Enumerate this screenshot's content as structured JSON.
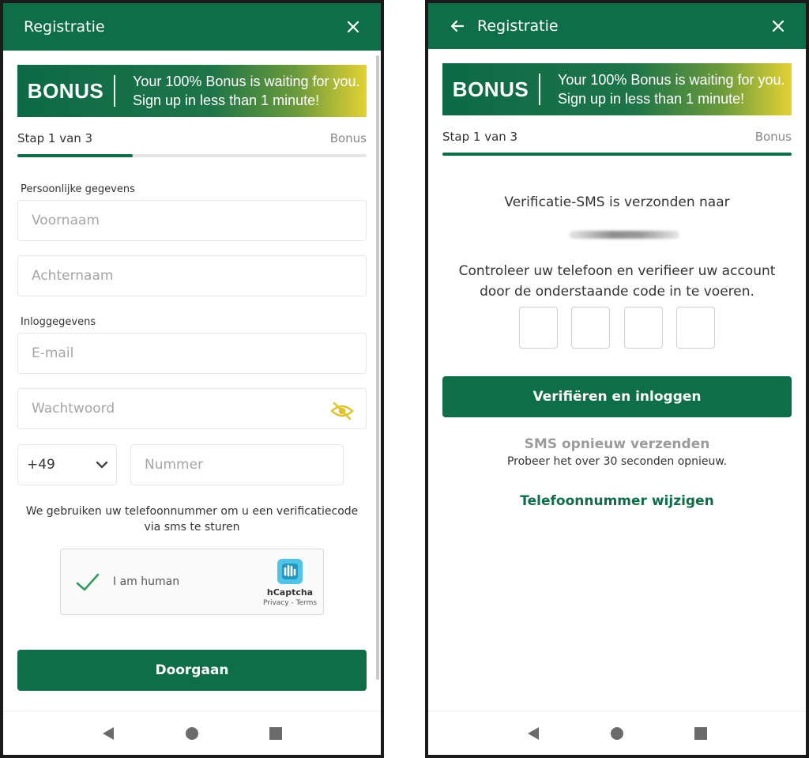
{
  "colors": {
    "brand_green": "#0e6e48",
    "banner_yellow": "#e3d232",
    "muted_text": "#9b9b9b"
  },
  "icons": {
    "close": "close-icon",
    "back": "arrow-left-icon",
    "eye": "eye-off-icon",
    "dropdown": "chevron-down-icon",
    "checkmark": "checkmark-icon",
    "captcha_logo": "hcaptcha-logo-icon"
  },
  "banner": {
    "brand": "BONUS",
    "line1": "Your 100% Bonus is waiting for you.",
    "line2": "Sign up in less than 1 minute!"
  },
  "left": {
    "header": {
      "title": "Registratie"
    },
    "step": {
      "label": "Stap 1 van 3",
      "right_label": "Bonus",
      "progress_fraction": 0.33
    },
    "sections": {
      "personal": "Persoonlijke gegevens",
      "login": "Inloggegevens"
    },
    "fields": {
      "first_name": {
        "placeholder": "Voornaam",
        "value": ""
      },
      "last_name": {
        "placeholder": "Achternaam",
        "value": ""
      },
      "email": {
        "placeholder": "E-mail",
        "value": ""
      },
      "password": {
        "placeholder": "Wachtwoord",
        "value": ""
      },
      "country_code": "+49",
      "number": {
        "placeholder": "Nummer",
        "value": ""
      }
    },
    "phone_info": "We gebruiken uw telefoonnummer om u een verificatiecode via sms te sturen",
    "captcha": {
      "label": "I am human",
      "brand": "hCaptcha",
      "links": "Privacy - Terms"
    },
    "submit_label": "Doorgaan"
  },
  "right": {
    "header": {
      "title": "Registratie"
    },
    "step": {
      "label": "Stap 1 van 3",
      "right_label": "Bonus",
      "progress_fraction": 1.0
    },
    "sms_sent": "Verificatie-SMS is verzonden naar",
    "instructions": "Controleer uw telefoon en verifieer uw account door de onderstaande code in te voeren.",
    "code_digits": [
      "",
      "",
      "",
      ""
    ],
    "verify_label": "Verifiëren en inloggen",
    "resend_label": "SMS opnieuw verzenden",
    "retry_text": "Probeer het over 30 seconden opnieuw.",
    "change_phone_label": "Telefoonnummer wijzigen"
  }
}
